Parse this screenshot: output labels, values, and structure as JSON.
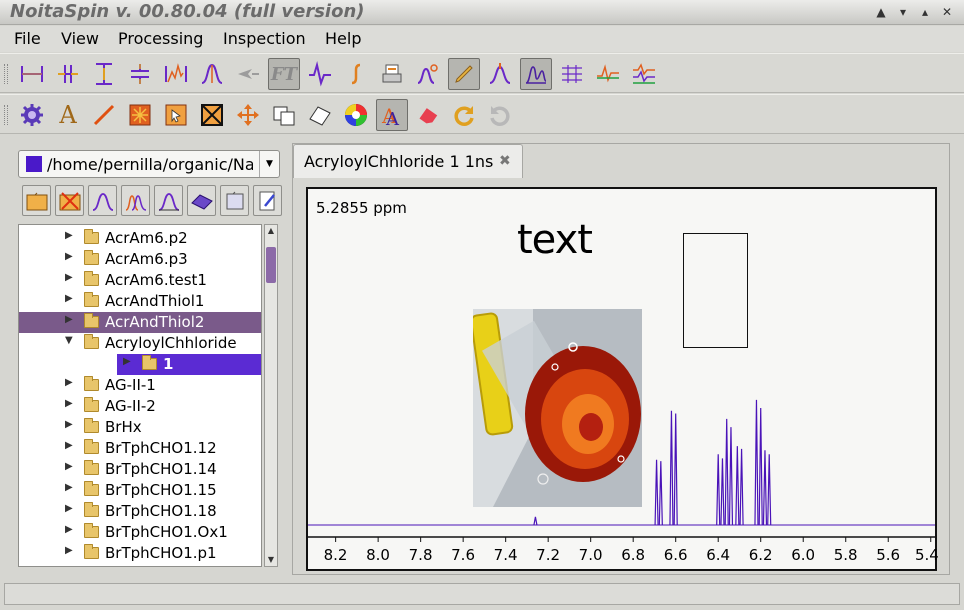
{
  "window": {
    "title": "NoitaSpin v. 00.80.04 (full version)"
  },
  "menu": [
    {
      "label": "File"
    },
    {
      "label": "View"
    },
    {
      "label": "Processing"
    },
    {
      "label": "Inspection"
    },
    {
      "label": "Help"
    }
  ],
  "toolbar1_icons": [
    "expand-h-icon",
    "shift-lr-icon",
    "expand-v-icon",
    "compress-v-icon",
    "zoom-spectrum-icon",
    "peak-pick-icon",
    "pointer-icon",
    "ft-icon",
    "phase-icon",
    "integral-icon",
    "print-icon",
    "peak-label-icon",
    "pencil-icon",
    "peak-icon",
    "grid-icon",
    "compare-icon",
    "overlay-icon"
  ],
  "toolbar1_ft_label": "FT",
  "toolbar2_icons": [
    "gear-icon",
    "text-icon",
    "line-icon",
    "burst-icon",
    "select-icon",
    "crossed-box-icon",
    "move-icon",
    "copy-icon",
    "eraser-shape-icon",
    "color-wheel-icon",
    "font-icon",
    "eraser-icon",
    "redo-icon",
    "undo-icon"
  ],
  "toolbar2_text_label": "A",
  "file_tools": [
    "folder-open-icon",
    "folder-close-icon",
    "spectrum-icon",
    "multi-spectrum-icon",
    "spectrum-alt-icon",
    "3d-spectrum-icon",
    "folder-copy-icon",
    "settings-doc-icon"
  ],
  "path": "/home/pernilla/organic/Nar",
  "tree": [
    {
      "label": "AcrAm6.p2",
      "level": 0,
      "state": "collapsed"
    },
    {
      "label": "AcrAm6.p3",
      "level": 0,
      "state": "collapsed"
    },
    {
      "label": "AcrAm6.test1",
      "level": 0,
      "state": "collapsed"
    },
    {
      "label": "AcrAndThiol1",
      "level": 0,
      "state": "collapsed"
    },
    {
      "label": "AcrAndThiol2",
      "level": 0,
      "state": "collapsed",
      "selected": true
    },
    {
      "label": "AcryloylChhloride",
      "level": 0,
      "state": "expanded"
    },
    {
      "label": "1",
      "level": 1,
      "state": "collapsed",
      "current": true
    },
    {
      "label": "AG-II-1",
      "level": 0,
      "state": "collapsed"
    },
    {
      "label": "AG-II-2",
      "level": 0,
      "state": "collapsed"
    },
    {
      "label": "BrHx",
      "level": 0,
      "state": "collapsed"
    },
    {
      "label": "BrTphCHO1.12",
      "level": 0,
      "state": "collapsed"
    },
    {
      "label": "BrTphCHO1.14",
      "level": 0,
      "state": "collapsed"
    },
    {
      "label": "BrTphCHO1.15",
      "level": 0,
      "state": "collapsed"
    },
    {
      "label": "BrTphCHO1.18",
      "level": 0,
      "state": "collapsed"
    },
    {
      "label": "BrTphCHO1.Ox1",
      "level": 0,
      "state": "collapsed"
    },
    {
      "label": "BrTphCHO1.p1",
      "level": 0,
      "state": "collapsed"
    }
  ],
  "tab": {
    "label": "AcryloylChhloride 1 1ns"
  },
  "spectrum": {
    "cursor_readout": "5.2855 ppm",
    "annotation_text": "text",
    "x_ticks": [
      "8.2",
      "8.0",
      "7.8",
      "7.6",
      "7.4",
      "7.2",
      "7.0",
      "6.8",
      "6.6",
      "6.4",
      "6.2",
      "6.0",
      "5.8",
      "5.6",
      "5.4"
    ],
    "line_color": "#4a13b8",
    "peaks_ppm": [
      {
        "x": 7.26,
        "h": 0.06
      },
      {
        "x": 6.69,
        "h": 0.48
      },
      {
        "x": 6.67,
        "h": 0.47
      },
      {
        "x": 6.62,
        "h": 0.84
      },
      {
        "x": 6.6,
        "h": 0.82
      },
      {
        "x": 6.4,
        "h": 0.52
      },
      {
        "x": 6.38,
        "h": 0.49
      },
      {
        "x": 6.36,
        "h": 0.78
      },
      {
        "x": 6.34,
        "h": 0.72
      },
      {
        "x": 6.31,
        "h": 0.58
      },
      {
        "x": 6.29,
        "h": 0.56
      },
      {
        "x": 6.22,
        "h": 0.92
      },
      {
        "x": 6.2,
        "h": 0.86
      },
      {
        "x": 6.18,
        "h": 0.55
      },
      {
        "x": 6.16,
        "h": 0.52
      }
    ]
  },
  "status": {
    "text": ""
  }
}
